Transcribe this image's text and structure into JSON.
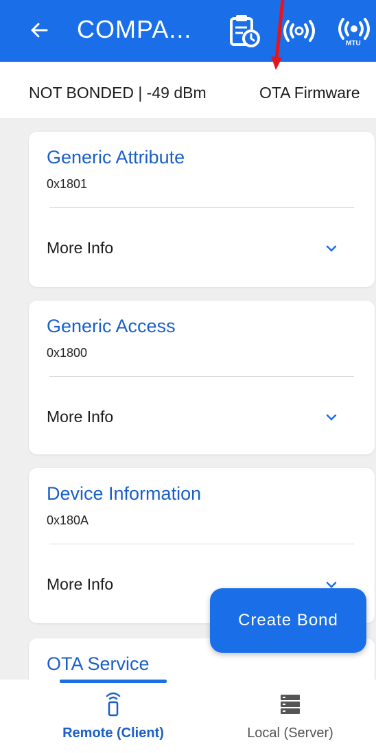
{
  "app_bar": {
    "title": "COMPA...",
    "back_icon": "arrow-left-icon",
    "actions": [
      "log-clipboard-icon",
      "rssi-signal-icon",
      "mtu-icon"
    ],
    "mtu_badge": "MTU",
    "color": "#1a6fe8"
  },
  "info_bar": {
    "status": "NOT BONDED | -49 dBm",
    "ota_label": "OTA Firmware"
  },
  "services": [
    {
      "name": "Generic Attribute",
      "uuid": "0x1801",
      "more_label": "More Info"
    },
    {
      "name": "Generic Access",
      "uuid": "0x1800",
      "more_label": "More Info"
    },
    {
      "name": "Device Information",
      "uuid": "0x180A",
      "more_label": "More Info"
    },
    {
      "name": "OTA Service"
    }
  ],
  "fab": {
    "label": "Create Bond"
  },
  "bottom_nav": {
    "items": [
      {
        "label": "Remote (Client)",
        "icon": "remote-client-icon",
        "selected": true
      },
      {
        "label": "Local (Server)",
        "icon": "server-icon",
        "selected": false
      }
    ]
  },
  "annotation": {
    "arrow_color": "#e8141b"
  }
}
